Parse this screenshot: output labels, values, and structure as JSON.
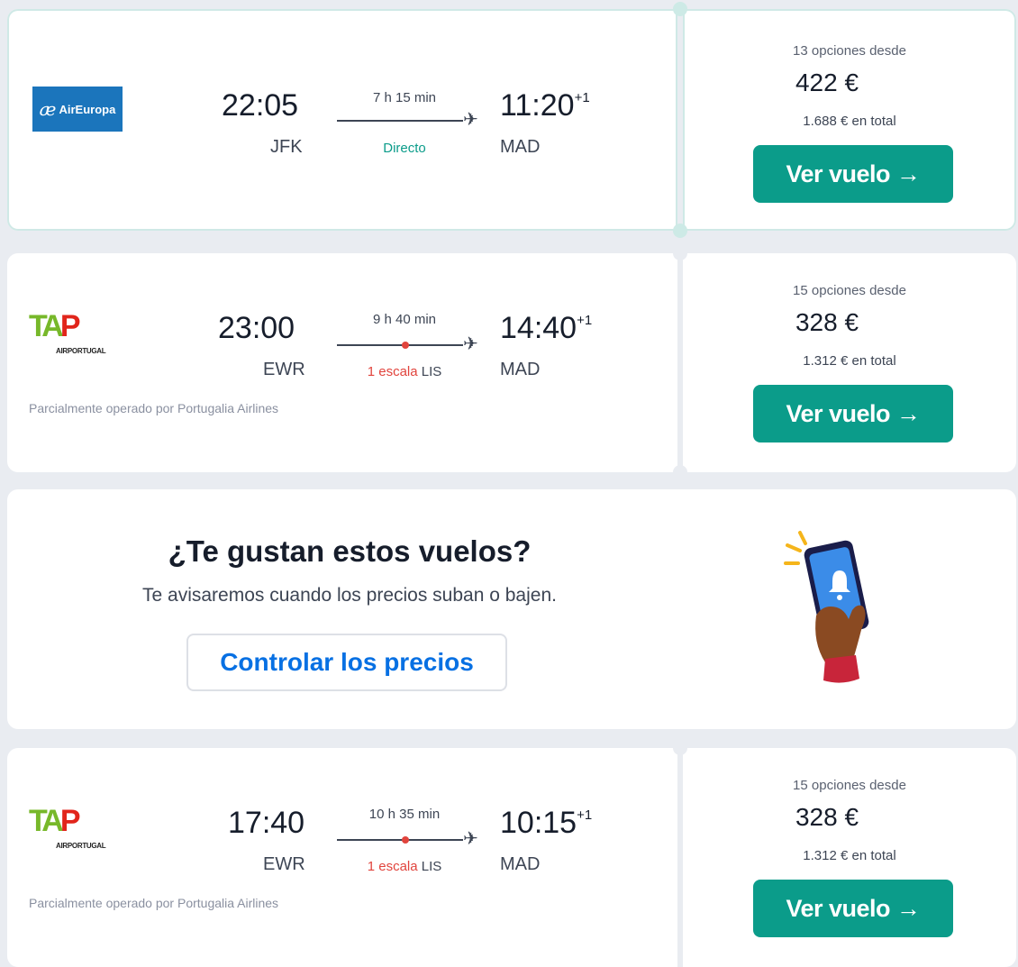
{
  "flights": [
    {
      "airline": "AirEuropa",
      "dep_time": "22:05",
      "dep_airport": "JFK",
      "duration": "7 h 15 min",
      "stops_label": "Directo",
      "arr_time": "11:20",
      "arr_offset": "+1",
      "arr_airport": "MAD",
      "options": "13 opciones desde",
      "price": "422 €",
      "total": "1.688 € en total",
      "button": "Ver vuelo →"
    },
    {
      "airline": "AIRPORTUGAL",
      "dep_time": "23:00",
      "dep_airport": "EWR",
      "duration": "9 h 40 min",
      "stops_label": "1 escala",
      "stop_code": "LIS",
      "arr_time": "14:40",
      "arr_offset": "+1",
      "arr_airport": "MAD",
      "operated_by": "Parcialmente operado por Portugalia Airlines",
      "options": "15 opciones desde",
      "price": "328 €",
      "total": "1.312 € en total",
      "button": "Ver vuelo →"
    },
    {
      "airline": "AIRPORTUGAL",
      "dep_time": "17:40",
      "dep_airport": "EWR",
      "duration": "10 h 35 min",
      "stops_label": "1 escala",
      "stop_code": "LIS",
      "arr_time": "10:15",
      "arr_offset": "+1",
      "arr_airport": "MAD",
      "operated_by": "Parcialmente operado por Portugalia Airlines",
      "options": "15 opciones desde",
      "price": "328 €",
      "total": "1.312 € en total",
      "button": "Ver vuelo →"
    }
  ],
  "promo": {
    "title": "¿Te gustan estos vuelos?",
    "subtitle": "Te avisaremos cuando los precios suban o bajen.",
    "button": "Controlar los precios"
  },
  "colors": {
    "accent": "#0b9c8a",
    "link": "#0770e3",
    "stop_red": "#e1443d",
    "background": "#e9ecf1"
  },
  "icons": {
    "plane": "airplane-icon",
    "phone_alert": "phone-bell-illustration"
  }
}
